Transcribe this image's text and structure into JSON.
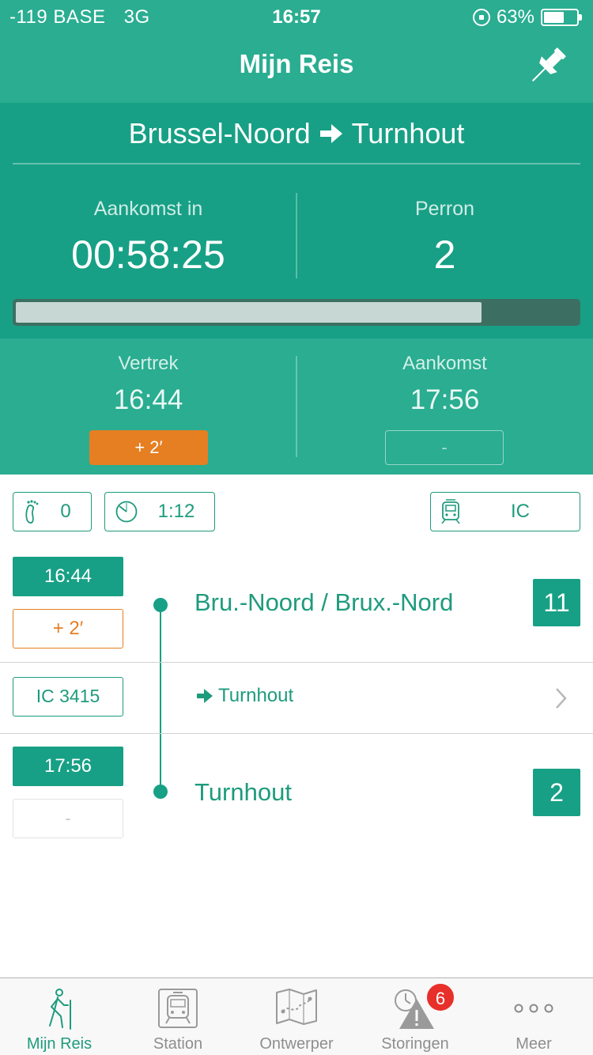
{
  "status_bar": {
    "carrier": "-119 BASE",
    "network": "3G",
    "time": "16:57",
    "battery": "63%",
    "battery_level": 0.63
  },
  "nav": {
    "title": "Mijn Reis"
  },
  "route": {
    "from": "Brussel-Noord",
    "to": "Turnhout"
  },
  "countdown": {
    "label": "Aankomst in",
    "value": "00:58:25"
  },
  "platform": {
    "label": "Perron",
    "value": "2"
  },
  "progress": {
    "fraction": 0.83
  },
  "departure": {
    "label": "Vertrek",
    "time": "16:44",
    "delay": "+ 2′"
  },
  "arrival": {
    "label": "Aankomst",
    "time": "17:56",
    "delay": "-"
  },
  "info": {
    "transfers": "0",
    "duration": "1:12",
    "train_type": "IC"
  },
  "journey": {
    "origin": {
      "time": "16:44",
      "delay": "+ 2′",
      "name": "Bru.-Noord / Brux.-Nord",
      "platform": "11"
    },
    "train": {
      "id": "IC  3415",
      "direction": "Turnhout"
    },
    "destination": {
      "time": "17:56",
      "delay": "-",
      "name": "Turnhout",
      "platform": "2"
    }
  },
  "tabs": [
    {
      "label": "Mijn Reis",
      "icon": "hiker-icon",
      "active": true
    },
    {
      "label": "Station",
      "icon": "train-icon"
    },
    {
      "label": "Ontwerper",
      "icon": "map-icon"
    },
    {
      "label": "Storingen",
      "icon": "warning-clock-icon",
      "badge": "6"
    },
    {
      "label": "Meer",
      "icon": "more-icon"
    }
  ],
  "colors": {
    "primary": "#17a085",
    "header": "#2aad91",
    "delay": "#e67e22",
    "badge": "#e8302b"
  }
}
